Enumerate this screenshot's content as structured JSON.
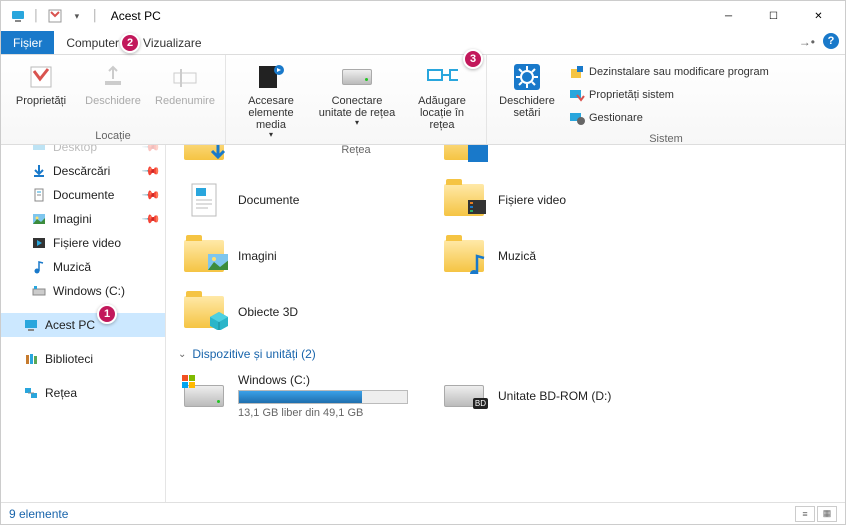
{
  "title": "Acest PC",
  "tabs": {
    "file": "Fișier",
    "computer": "Computer",
    "view": "Vizualizare"
  },
  "ribbon": {
    "location_group": "Locație",
    "network_group": "Rețea",
    "system_group": "Sistem",
    "properties": "Proprietăți",
    "open": "Deschidere",
    "rename": "Redenumire",
    "access_media": "Accesare elemente media",
    "connect_drive": "Conectare unitate de rețea",
    "add_location": "Adăugare locație în rețea",
    "open_settings": "Deschidere setări",
    "uninstall": "Dezinstalare sau modificare program",
    "sys_props": "Proprietăți sistem",
    "manage": "Gestionare"
  },
  "sidebar": {
    "desktop_cut": "Desktop",
    "downloads": "Descărcări",
    "documents": "Documente",
    "pictures": "Imagini",
    "videos": "Fișiere video",
    "music": "Muzică",
    "c_drive": "Windows (C:)",
    "this_pc": "Acest PC",
    "libraries": "Biblioteci",
    "network": "Rețea"
  },
  "folders": {
    "documents": "Documente",
    "videos": "Fișiere video",
    "pictures": "Imagini",
    "music": "Muzică",
    "objects3d": "Obiecte 3D"
  },
  "devices_header": "Dispozitive și unități (2)",
  "drives": {
    "c": {
      "name": "Windows (C:)",
      "free": "13,1 GB liber din 49,1 GB",
      "fill_pct": 73
    },
    "d": {
      "name": "Unitate BD-ROM (D:)"
    }
  },
  "status": "9 elemente",
  "badges": {
    "b1": "1",
    "b2": "2",
    "b3": "3"
  }
}
